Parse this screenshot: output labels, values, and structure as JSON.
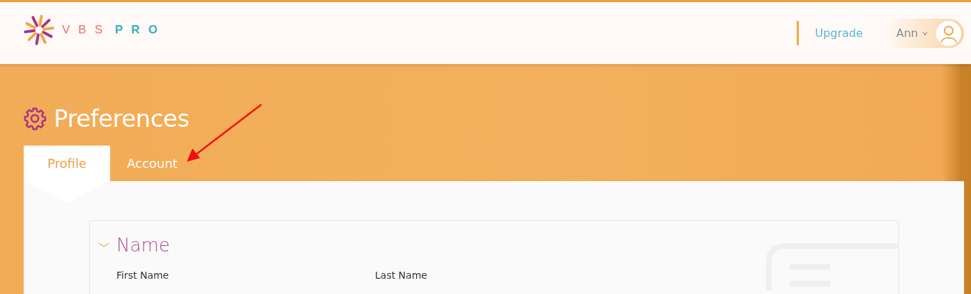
{
  "logo": {
    "part_1": "VBS",
    "part_2": "PRO"
  },
  "header": {
    "upgrade_link": "Upgrade",
    "user_name": "Ann"
  },
  "page_title": "Preferences",
  "tabs": [
    {
      "label": "Profile",
      "selected": true
    },
    {
      "label": "Account",
      "selected": false
    }
  ],
  "section": {
    "title": "Name",
    "expanded": true,
    "fields": [
      {
        "label": "First Name"
      },
      {
        "label": "Last Name"
      }
    ]
  }
}
